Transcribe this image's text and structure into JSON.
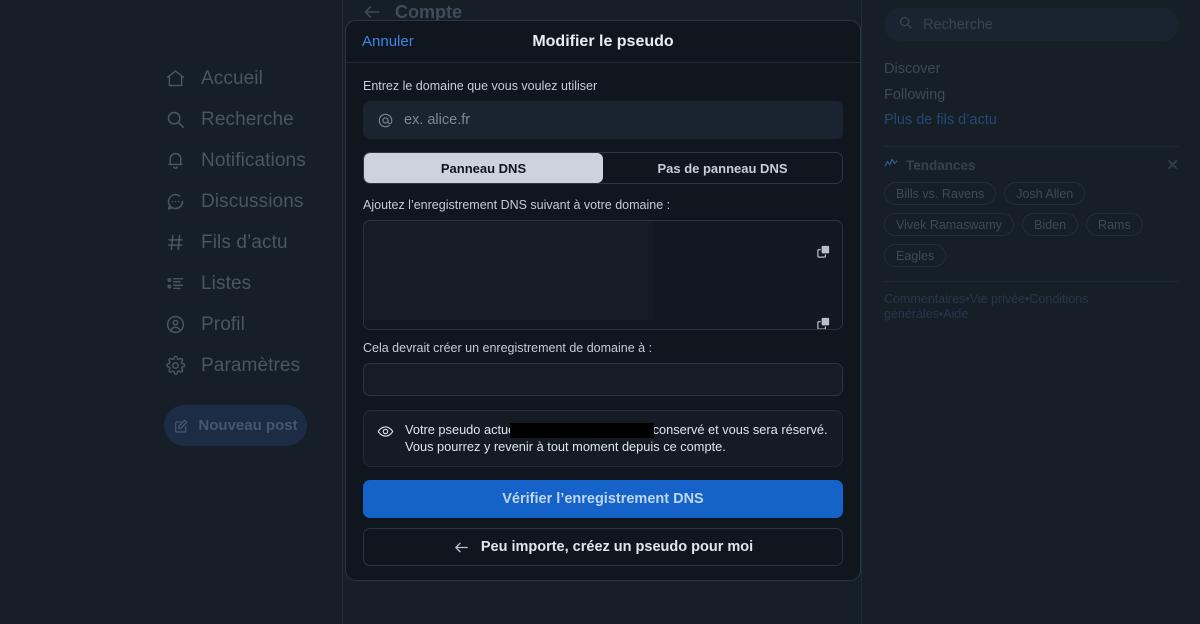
{
  "sidebar": {
    "items": [
      {
        "label": "Accueil",
        "icon": "home-icon"
      },
      {
        "label": "Recherche",
        "icon": "search-icon"
      },
      {
        "label": "Notifications",
        "icon": "bell-icon"
      },
      {
        "label": "Discussions",
        "icon": "chat-bubble-icon"
      },
      {
        "label": "Fils d’actu",
        "icon": "hash-icon"
      },
      {
        "label": "Listes",
        "icon": "list-icon"
      },
      {
        "label": "Profil",
        "icon": "user-circle-icon"
      },
      {
        "label": "Paramètres",
        "icon": "gear-icon"
      }
    ],
    "compose_label": "Nouveau post",
    "compose_icon": "compose-pencil-icon"
  },
  "center": {
    "title": "Compte",
    "back_icon": "arrow-left-icon"
  },
  "right_rail": {
    "search_placeholder": "Recherche",
    "search_icon": "search-icon",
    "feed_links": [
      {
        "label": "Discover",
        "accent": false
      },
      {
        "label": "Following",
        "accent": false
      },
      {
        "label": "Plus de fils d’actu",
        "accent": true
      }
    ],
    "trends": {
      "icon": "trend-line-icon",
      "title": "Tendances",
      "close_icon": "close-icon",
      "pills": [
        "Bills vs. Ravens",
        "Josh Allen",
        "Vivek Ramaswamy",
        "Biden",
        "Rams",
        "Eagles"
      ]
    },
    "footer": {
      "links": [
        "Commentaires",
        "Vie privée",
        "Conditions générales",
        "Aide"
      ],
      "separator": "•"
    }
  },
  "modal": {
    "cancel_label": "Annuler",
    "title": "Modifier le pseudo",
    "domain_label": "Entrez le domaine que vous voulez utiliser",
    "domain_placeholder": "ex. alice.fr",
    "domain_value": "",
    "at_icon": "at-sign-icon",
    "segments": [
      {
        "label": "Panneau DNS",
        "active": true
      },
      {
        "label": "Pas de panneau DNS",
        "active": false
      }
    ],
    "dns_instruction": "Ajoutez l’enregistrement DNS suivant à votre domaine :",
    "dns_record_value": "",
    "copy_icon": "copy-icon",
    "record_label": "Cela devrait créer un enregistrement de domaine à :",
    "record_value": "",
    "notice": {
      "icon": "eye-icon",
      "text_before": "Votre pseudo actuel",
      "redacted_value": "",
      "text_after": "sera automatiquement conservé et vous sera réservé. Vous pourrez y revenir à tout moment depuis ce compte."
    },
    "primary_button": "Vérifier l’enregistrement DNS",
    "secondary_button": "Peu importe, créez un pseudo pour moi",
    "secondary_icon": "arrow-left-icon"
  },
  "colors": {
    "page_bg": "#161e27",
    "modal_bg": "#10161e",
    "accent_blue": "#1562c8",
    "link_blue": "#3d84e8",
    "segment_active_bg": "#ccd3dc"
  }
}
